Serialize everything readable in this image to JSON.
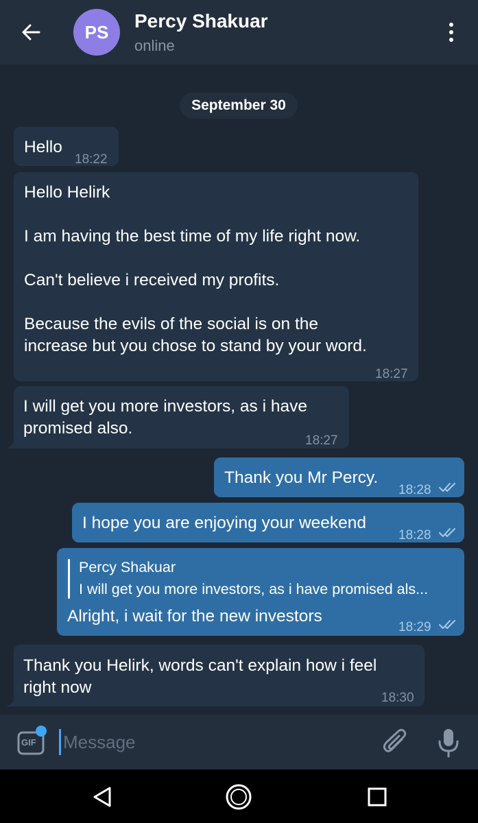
{
  "header": {
    "avatar_initials": "PS",
    "contact_name": "Percy Shakuar",
    "status": "online"
  },
  "date_separator": "September 30",
  "messages": [
    {
      "direction": "incoming",
      "lines": [
        "Hello"
      ],
      "time": "18:22"
    },
    {
      "direction": "incoming",
      "lines": [
        "Hello Helirk",
        "",
        "I am having the best time  of my life right now.",
        "",
        "Can't believe i received my profits.",
        "",
        "Because the evils of the social is on the",
        "increase but you chose to stand by your word."
      ],
      "time": "18:27"
    },
    {
      "direction": "incoming",
      "lines": [
        "I will get you more investors, as i have",
        "promised also."
      ],
      "time": "18:27"
    },
    {
      "direction": "outgoing",
      "lines": [
        "Thank you Mr Percy."
      ],
      "time": "18:28",
      "read": true
    },
    {
      "direction": "outgoing",
      "lines": [
        "I hope you are enjoying your weekend"
      ],
      "time": "18:28",
      "read": true
    },
    {
      "direction": "outgoing",
      "reply_to": {
        "name": "Percy Shakuar",
        "text": "I will get you more investors, as i have promised als..."
      },
      "lines": [
        "Alright, i wait for the new investors"
      ],
      "time": "18:29",
      "read": true
    },
    {
      "direction": "incoming",
      "lines": [
        "Thank you Helirk, words can't explain how i feel",
        "right now"
      ],
      "time": "18:30"
    }
  ],
  "input": {
    "placeholder": "Message",
    "gif_label": "GIF"
  },
  "icons": {
    "back": "arrow-left-icon",
    "menu": "more-vertical-icon",
    "gif": "gif-icon",
    "attach": "paperclip-icon",
    "mic": "microphone-icon",
    "read_status": "double-check-icon",
    "nav_back": "triangle-back-icon",
    "nav_home": "circle-home-icon",
    "nav_recent": "square-recents-icon"
  },
  "colors": {
    "background": "#1d2733",
    "header": "#242f3d",
    "incoming_bubble": "#243446",
    "outgoing_bubble": "#2f6ea5",
    "avatar": "#8d7ee6",
    "accent": "#3ea6f5"
  }
}
